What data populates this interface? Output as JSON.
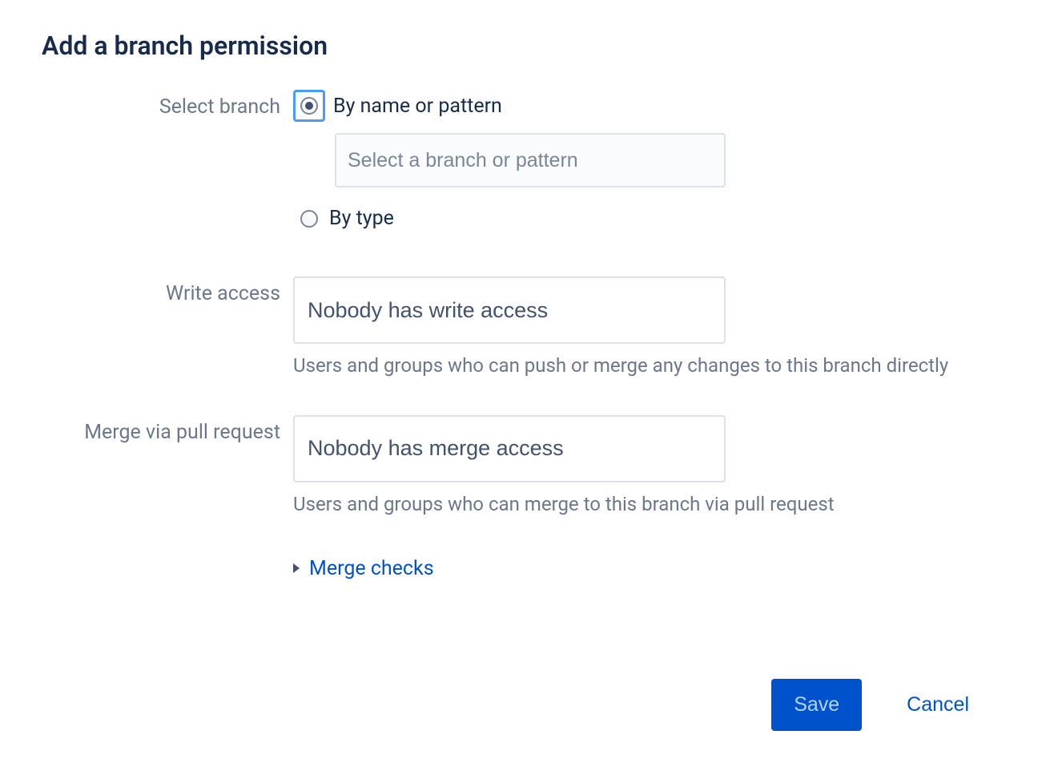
{
  "dialog": {
    "title": "Add a branch permission"
  },
  "selectBranch": {
    "label": "Select branch",
    "options": {
      "byName": "By name or pattern",
      "byType": "By type"
    },
    "inputPlaceholder": "Select a branch or pattern"
  },
  "writeAccess": {
    "label": "Write access",
    "value": "Nobody has write access",
    "help": "Users and groups who can push or merge any changes to this branch directly"
  },
  "mergeAccess": {
    "label": "Merge via pull request",
    "value": "Nobody has merge access",
    "help": "Users and groups who can merge to this branch via pull request"
  },
  "mergeChecks": {
    "label": "Merge checks"
  },
  "footer": {
    "save": "Save",
    "cancel": "Cancel"
  }
}
